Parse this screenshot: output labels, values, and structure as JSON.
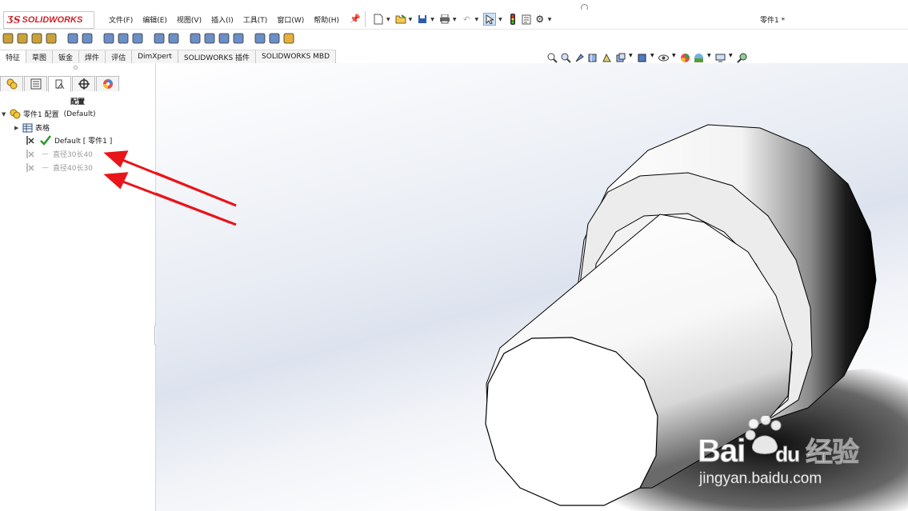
{
  "app": {
    "logo_ds": "ƷS",
    "logo_name": "SOLIDWORKS",
    "document_title": "零件1 *"
  },
  "menu": [
    {
      "label": "文件(F)"
    },
    {
      "label": "编辑(E)"
    },
    {
      "label": "视图(V)"
    },
    {
      "label": "插入(I)"
    },
    {
      "label": "工具(T)"
    },
    {
      "label": "窗口(W)"
    },
    {
      "label": "帮助(H)"
    }
  ],
  "command_tabs": [
    {
      "label": "特征",
      "active": true
    },
    {
      "label": "草图",
      "active": false
    },
    {
      "label": "钣金",
      "active": false
    },
    {
      "label": "焊件",
      "active": false
    },
    {
      "label": "评估",
      "active": false
    },
    {
      "label": "DimXpert",
      "active": false
    },
    {
      "label": "SOLIDWORKS 插件",
      "active": false
    },
    {
      "label": "SOLIDWORKS MBD",
      "active": false
    }
  ],
  "panel": {
    "title": "配置",
    "tabs": [
      {
        "icon": "feature-manager-icon"
      },
      {
        "icon": "property-manager-icon"
      },
      {
        "icon": "configuration-manager-icon",
        "active": true
      },
      {
        "icon": "dimxpert-manager-icon"
      },
      {
        "icon": "display-manager-icon"
      }
    ],
    "tree": {
      "root_label": "零件1 配置",
      "root_suffix": "(Default)",
      "tables_label": "表格",
      "configs": [
        {
          "label": "Default [ 零件1 ]",
          "active": true
        },
        {
          "label": "直径30长40",
          "active": false
        },
        {
          "label": "直径40长30",
          "active": false
        }
      ]
    }
  },
  "watermark": {
    "brand": "Bai",
    "brand2": "du",
    "suffix": "经验",
    "url": "jingyan.baidu.com"
  },
  "colors": {
    "brand_red": "#d2232a",
    "annotation_arrow": "#e8151b",
    "active_check": "#2e9b2e"
  }
}
